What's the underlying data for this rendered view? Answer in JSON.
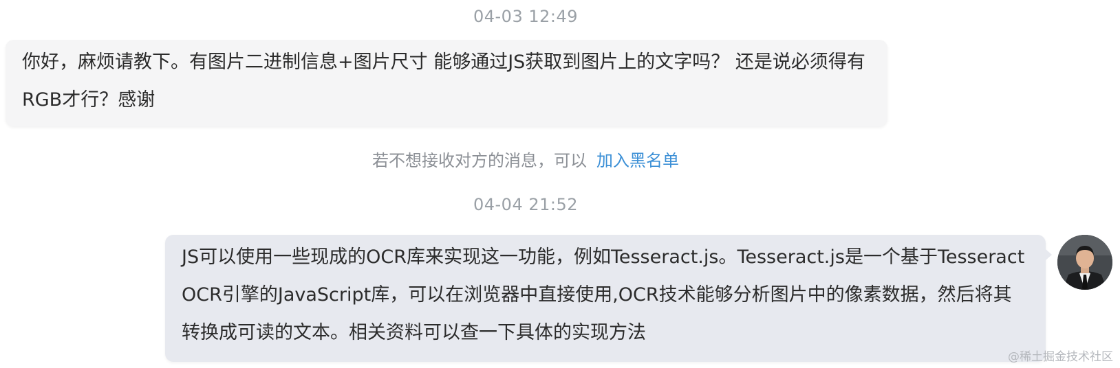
{
  "conversation": {
    "messages": [
      {
        "timestamp": "04-03 12:49",
        "direction": "incoming",
        "text": "你好，麻烦请教下。有图片二进制信息+图片尺寸 能够通过JS获取到图片上的文字吗？ 还是说必须得有RGB才行？感谢"
      },
      {
        "timestamp": "04-04 21:52",
        "direction": "outgoing",
        "text": "JS可以使用一些现成的OCR库来实现这一功能，例如Tesseract.js。Tesseract.js是一个基于Tesseract OCR引擎的JavaScript库，可以在浏览器中直接使用,OCR技术能够分析图片中的像素数据，然后将其转换成可读的文本。相关资料可以查一下具体的实现方法"
      }
    ],
    "block_notice": {
      "text": "若不想接收对方的消息，可以",
      "link_label": "加入黑名单"
    }
  },
  "avatar": {
    "icon": "user-avatar-photo"
  },
  "watermark": "@稀土掘金技术社区",
  "colors": {
    "incoming_bubble": "#f5f5f6",
    "outgoing_bubble": "#e7e9ef",
    "link": "#3b8fd6",
    "timestamp": "#9aa0a6"
  }
}
